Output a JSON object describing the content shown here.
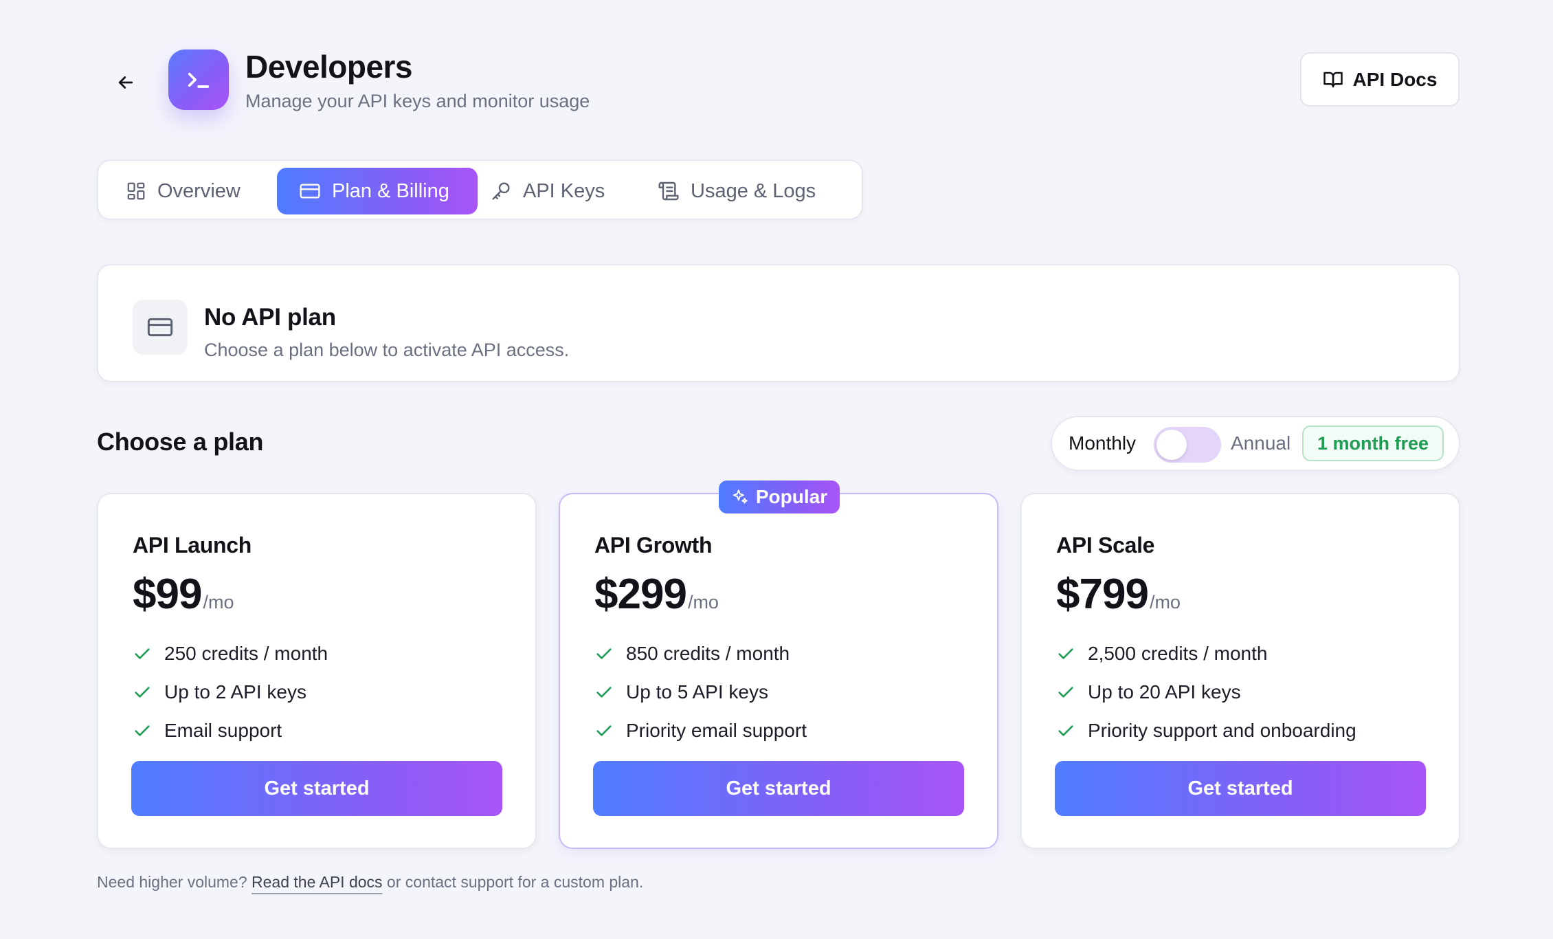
{
  "header": {
    "title": "Developers",
    "subtitle": "Manage your API keys and monitor usage",
    "api_docs_label": "API Docs"
  },
  "tabs": [
    {
      "label": "Overview",
      "icon": "grid-icon",
      "active": false
    },
    {
      "label": "Plan & Billing",
      "icon": "credit-card-icon",
      "active": true
    },
    {
      "label": "API Keys",
      "icon": "key-icon",
      "active": false
    },
    {
      "label": "Usage & Logs",
      "icon": "scroll-icon",
      "active": false
    }
  ],
  "status": {
    "title": "No API plan",
    "text": "Choose a plan below to activate API access."
  },
  "plans_section": {
    "title": "Choose a plan",
    "toggle": {
      "monthly_label": "Monthly",
      "annual_label": "Annual",
      "badge": "1 month free",
      "annual_selected": false
    },
    "popular_label": "Popular"
  },
  "plans": [
    {
      "name": "API Launch",
      "price": "$99",
      "period": "/mo",
      "features": [
        "250 credits / month",
        "Up to 2 API keys",
        "Email support"
      ],
      "cta": "Get started"
    },
    {
      "name": "API Growth",
      "price": "$299",
      "period": "/mo",
      "features": [
        "850 credits / month",
        "Up to 5 API keys",
        "Priority email support"
      ],
      "cta": "Get started"
    },
    {
      "name": "API Scale",
      "price": "$799",
      "period": "/mo",
      "features": [
        "2,500 credits / month",
        "Up to 20 API keys",
        "Priority support and onboarding"
      ],
      "cta": "Get started"
    }
  ],
  "footer": {
    "prefix": "Need higher volume? ",
    "link": "Read the API docs",
    "suffix": " or contact support for a custom plan."
  },
  "colors": {
    "accent_start": "#4f7cff",
    "accent_end": "#a855f7",
    "success": "#1f9d55",
    "background": "#f4f5fb"
  }
}
